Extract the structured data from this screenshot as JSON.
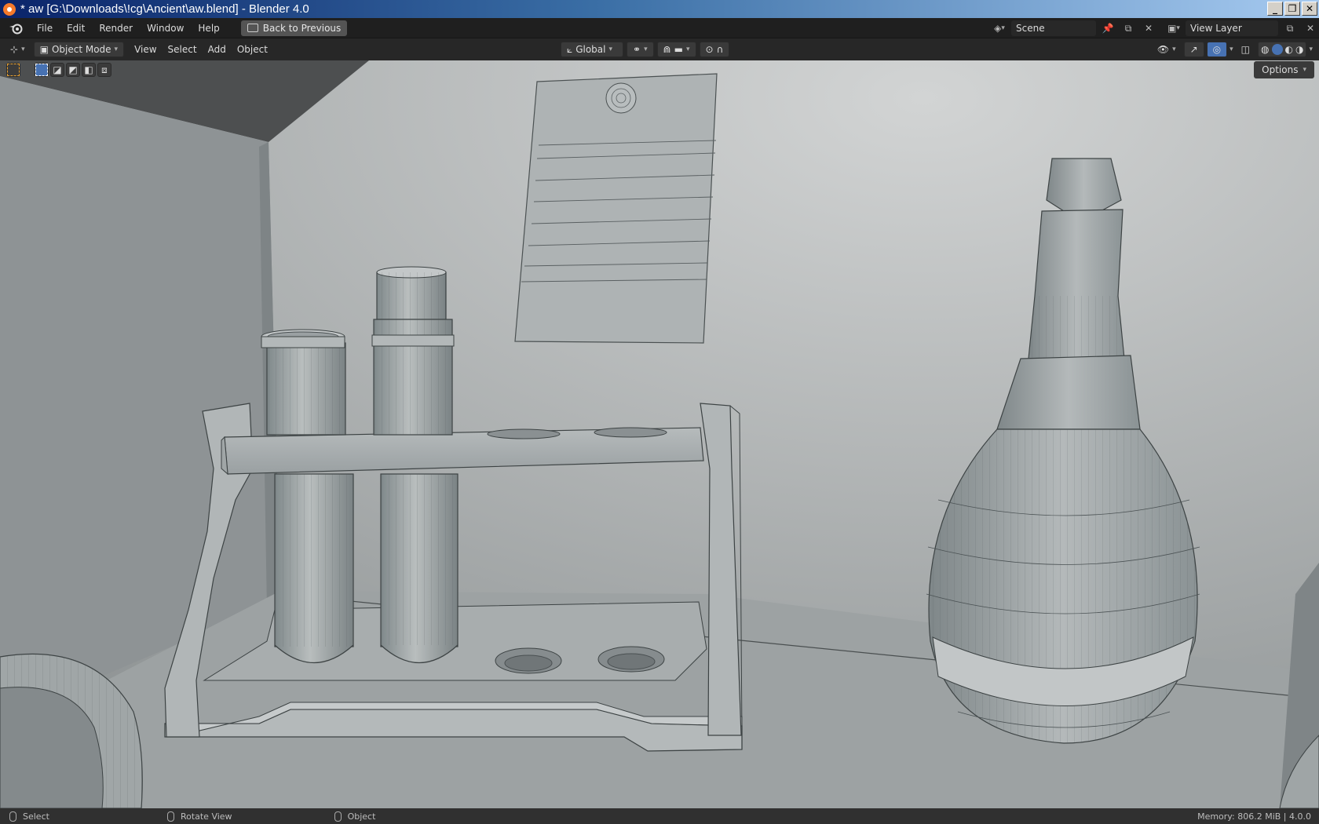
{
  "window": {
    "title": "* aw [G:\\Downloads\\!cg\\Ancient\\aw.blend] - Blender 4.0",
    "buttons": [
      "_",
      "❐",
      "✕"
    ]
  },
  "topbar": {
    "menus": [
      "File",
      "Edit",
      "Render",
      "Window",
      "Help"
    ],
    "back_button": "Back to Previous",
    "scene_name": "Scene",
    "view_layer": "View Layer"
  },
  "viewport_header": {
    "mode": "Object Mode",
    "menus": [
      "View",
      "Select",
      "Add",
      "Object"
    ],
    "transform_orientation": "Global"
  },
  "viewport": {
    "options_label": "Options",
    "objects": [
      "test-tube-rack",
      "test-tube-left",
      "test-tube-right",
      "pinned-note",
      "round-flask",
      "bowl"
    ]
  },
  "statusbar": {
    "left_click": "Select",
    "middle_click": "Rotate View",
    "right_click": "Object",
    "memory": "Memory: 806.2 MiB | 4.0.0"
  }
}
